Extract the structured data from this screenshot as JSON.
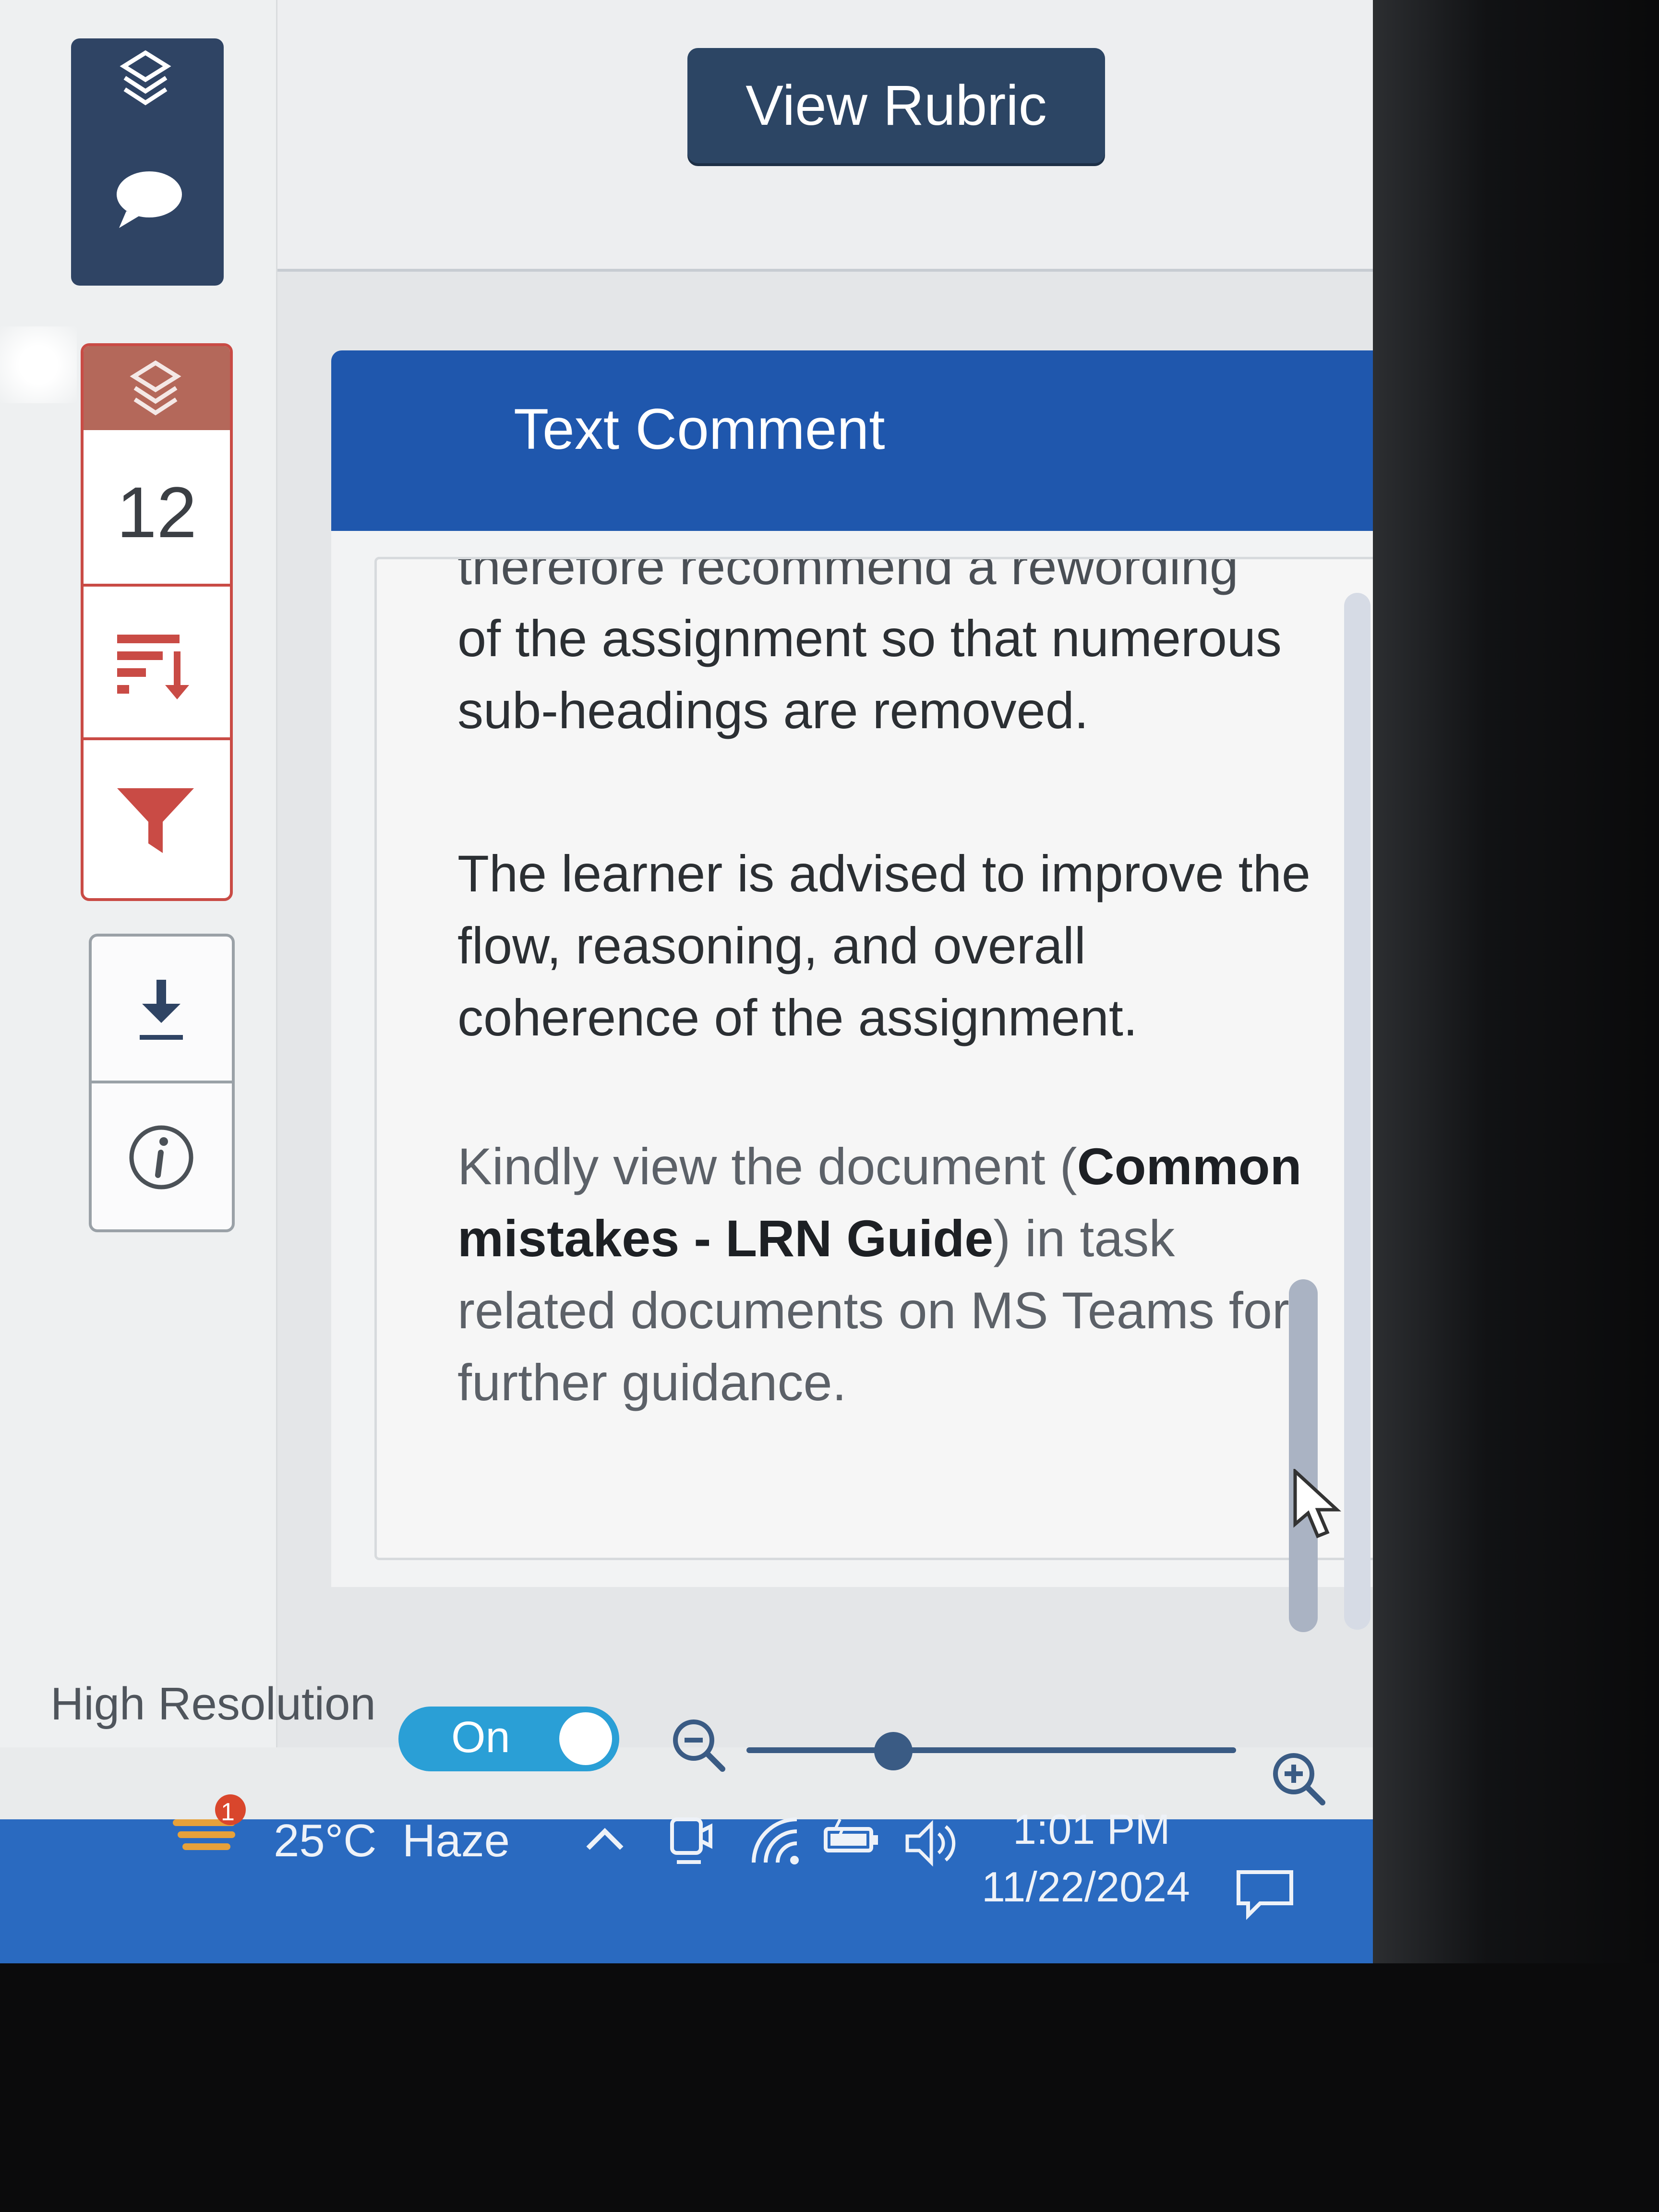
{
  "sidebar": {
    "page_count": "12"
  },
  "header": {
    "view_rubric_label": "View Rubric"
  },
  "comment": {
    "title": "Text Comment",
    "cut_line": "therefore recommend a rewording",
    "paragraph1": "of the assignment so that numerous sub-headings are removed.",
    "paragraph2": "The learner is advised to improve the flow, reasoning, and overall coherence of the assignment.",
    "paragraph3_prefix": "Kindly view the document (",
    "paragraph3_bold": "Common mistakes - LRN Guide",
    "paragraph3_suffix": ") in task related documents on MS Teams for further guidance."
  },
  "controls": {
    "high_resolution_label": "High Resolution",
    "toggle_label": "On",
    "zoom_level": 0.3
  },
  "taskbar": {
    "weather": "25°C  Haze",
    "weather_badge": "1",
    "time": "1:01 PM",
    "date": "11/22/2024"
  },
  "colors": {
    "comment_header": "#1f57ad",
    "rubric_button": "#2c4564",
    "tool_accent": "#c94b45",
    "toggle_on": "#2a9fd6",
    "taskbar": "#2a6ac0"
  }
}
